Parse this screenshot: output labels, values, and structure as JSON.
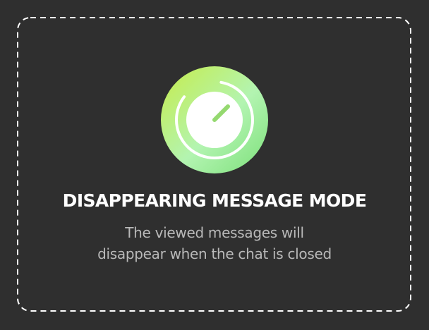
{
  "theme": {
    "background": "#2f2f2f",
    "border_color": "#ffffff",
    "title_color": "#ffffff",
    "text_color": "#b9b9b9",
    "accent_gradient": [
      "#c6ec49",
      "#b3f4b1",
      "#7ce07a"
    ]
  },
  "card": {
    "icon": "timer-icon",
    "title": "DISAPPEARING MESSAGE MODE",
    "description_lines": [
      "The viewed messages will",
      "disappear when the chat is closed"
    ]
  }
}
